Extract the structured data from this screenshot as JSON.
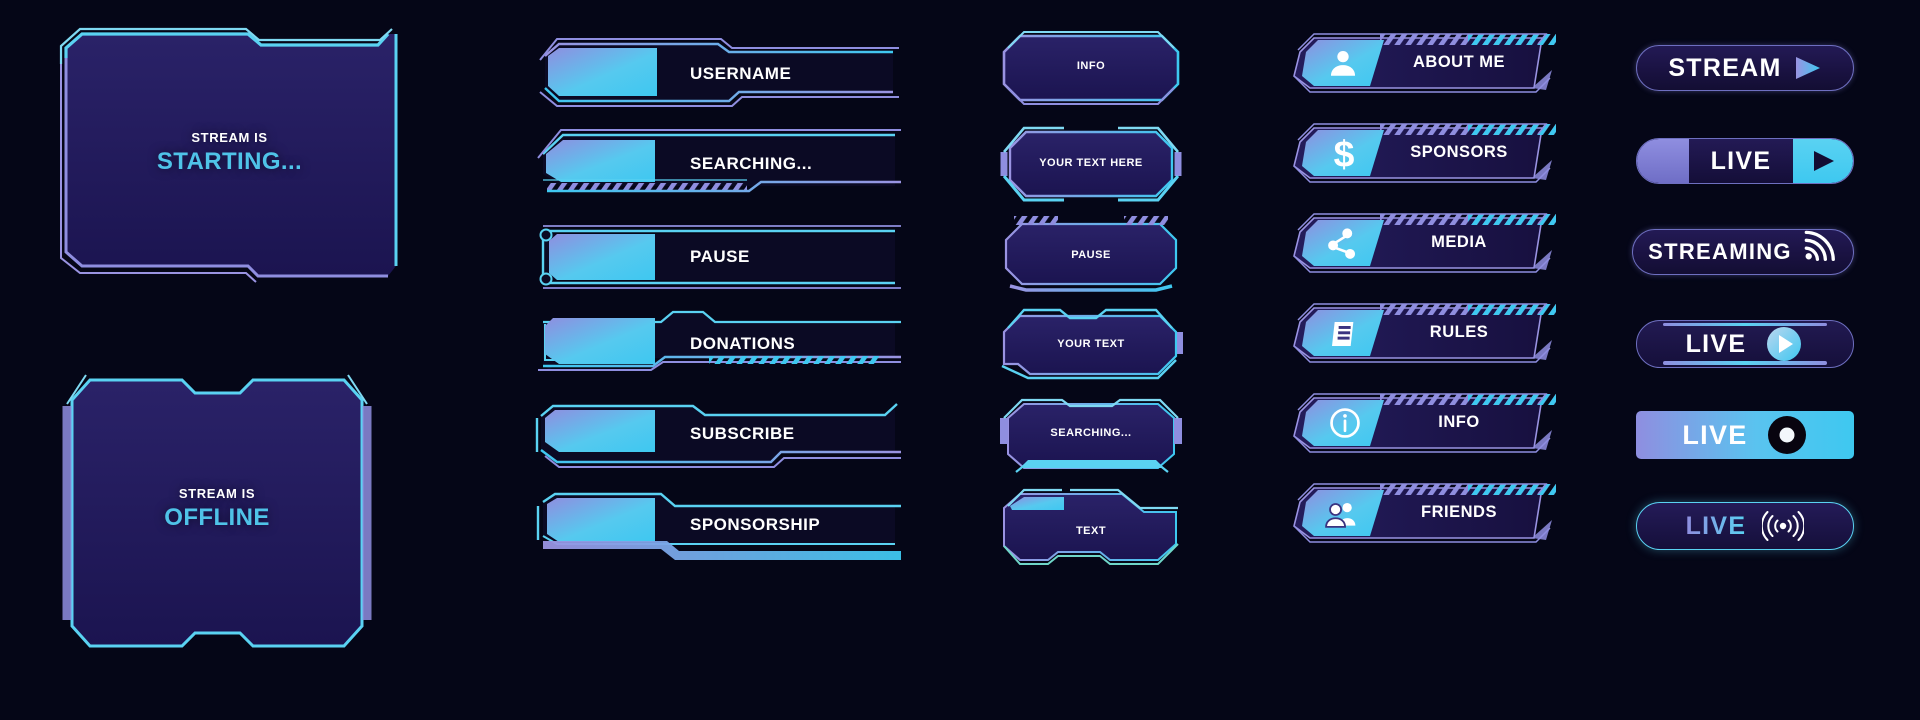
{
  "palette": {
    "background": "#050617",
    "cyan": "#3ec8f0",
    "light_cyan": "#7fd9f2",
    "periwinkle": "#8f8ee0",
    "violet": "#6e6fc0",
    "panel_dark": "#241d5e",
    "panel_darker": "#1a1447",
    "white": "#ffffff"
  },
  "stream_frames": [
    {
      "name": "stream-starting-frame",
      "line1": "STREAM IS",
      "line2": "STARTING..."
    },
    {
      "name": "stream-offline-frame",
      "line1": "STREAM IS",
      "line2": "OFFLINE"
    }
  ],
  "lower_thirds_wide": [
    {
      "label": "USERNAME",
      "style": "chamfer-right"
    },
    {
      "label": "SEARCHING...",
      "style": "hatched-underline"
    },
    {
      "label": "PAUSE",
      "style": "dot-left"
    },
    {
      "label": "DONATIONS",
      "style": "notched-top"
    },
    {
      "label": "SUBSCRIBE",
      "style": "step-right"
    },
    {
      "label": "SPONSORSHIP",
      "style": "double-bar"
    }
  ],
  "panels": [
    {
      "label": "INFO",
      "style": "octagon-flat"
    },
    {
      "label": "YOUR TEXT HERE",
      "style": "octagon-bracket"
    },
    {
      "label": "PAUSE",
      "style": "hatch-corners"
    },
    {
      "label": "YOUR TEXT",
      "style": "angled-corners"
    },
    {
      "label": "SEARCHING...",
      "style": "side-rails"
    },
    {
      "label": "TEXT",
      "style": "slanted-top"
    }
  ],
  "icon_bars": [
    {
      "label": "ABOUT ME",
      "icon": "user-icon"
    },
    {
      "label": "SPONSORS",
      "icon": "dollar-icon"
    },
    {
      "label": "MEDIA",
      "icon": "share-network-icon"
    },
    {
      "label": "RULES",
      "icon": "document-list-icon"
    },
    {
      "label": "INFO",
      "icon": "info-circle-icon"
    },
    {
      "label": "FRIENDS",
      "icon": "users-group-icon"
    }
  ],
  "live_buttons": [
    {
      "label": "STREAM",
      "icon": "play-triangle-icon",
      "style": "outline-pill"
    },
    {
      "label": "LIVE",
      "icon": "play-square-icon",
      "style": "split-pill"
    },
    {
      "label": "STREAMING",
      "icon": "broadcast-wifi-icon",
      "style": "outline-pill-wifi"
    },
    {
      "label": "LIVE",
      "icon": "play-circle-icon",
      "style": "outline-pill-circle"
    },
    {
      "label": "LIVE",
      "icon": "record-dot-icon",
      "style": "solid-gradient-bar"
    },
    {
      "label": "LIVE",
      "icon": "signal-waves-icon",
      "style": "outline-pill-signal"
    }
  ]
}
